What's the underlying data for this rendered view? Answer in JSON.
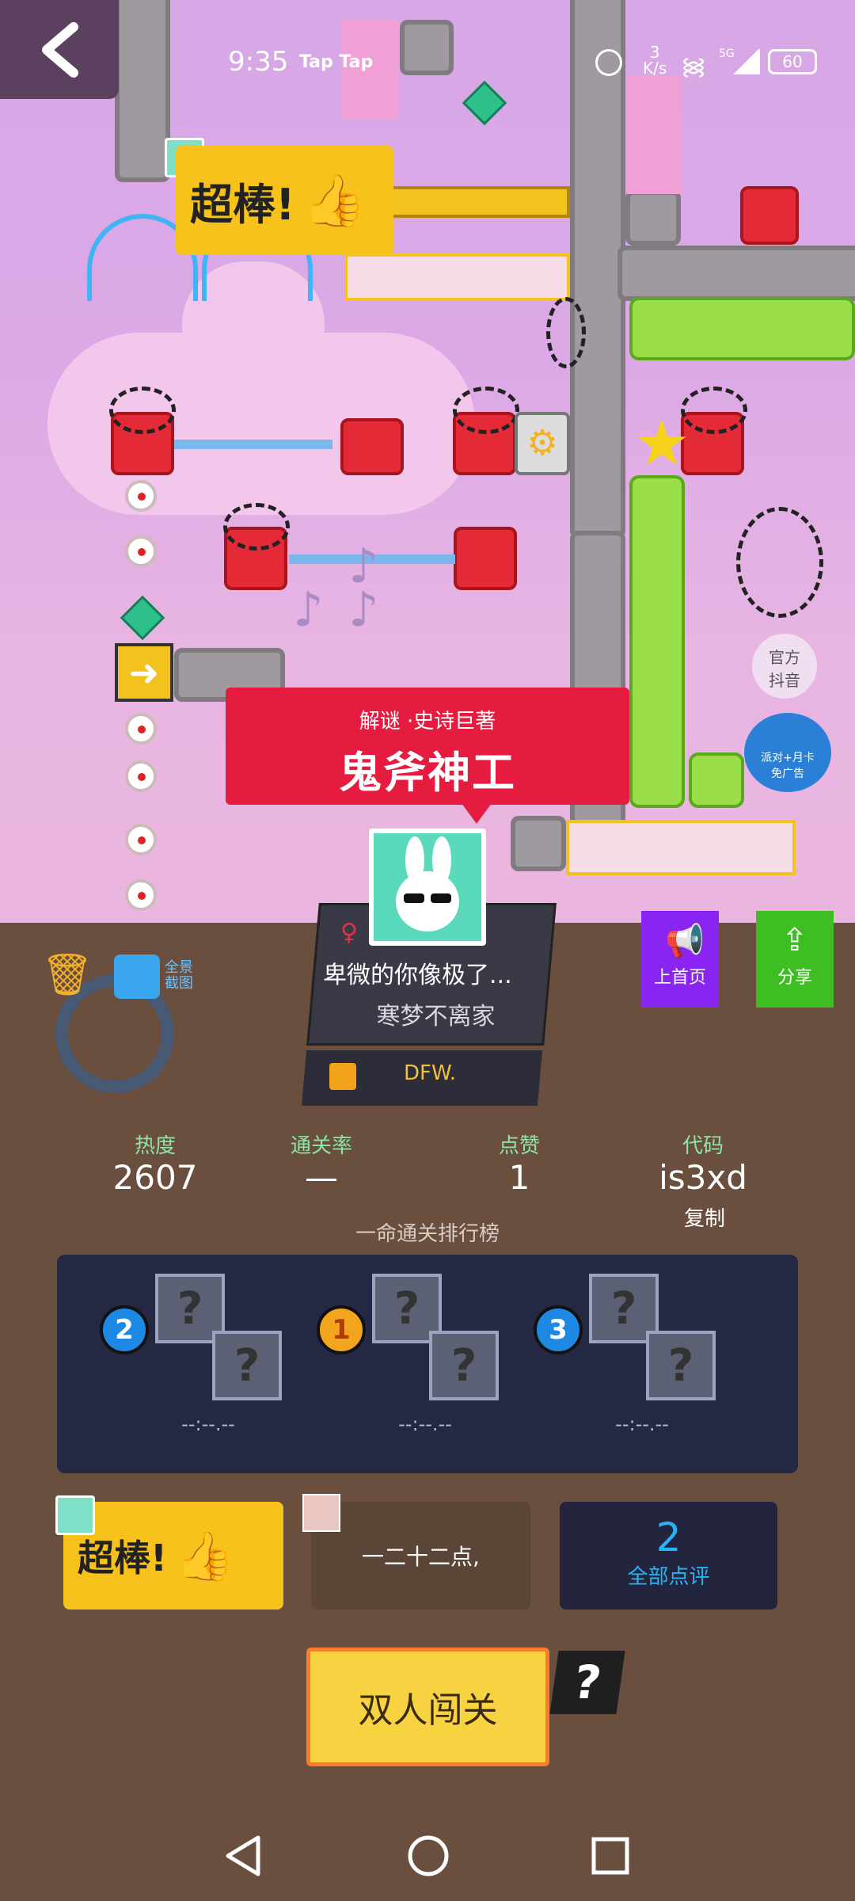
{
  "status": {
    "time": "9:35",
    "app_tags": "Tap Tap",
    "net_speed_value": "3",
    "net_speed_unit": "K/s",
    "battery": "60",
    "network": "5G"
  },
  "game": {
    "stickers": {
      "great": "超棒!"
    },
    "badges": {
      "official": "官方\n抖音",
      "promo": "派对+月卡\n免广告"
    }
  },
  "banner": {
    "subtitle": "解谜 ·史诗巨著",
    "title": "鬼斧神工"
  },
  "author": {
    "level_title": "卑微的你像极了...",
    "name": "寒梦不离家",
    "tag": "DFW."
  },
  "actions": {
    "home": "上首页",
    "share": "分享",
    "screenshot": "全景\n截图"
  },
  "stats": [
    {
      "label": "热度",
      "value": "2607"
    },
    {
      "label": "通关率",
      "value": "—"
    },
    {
      "label": "点赞",
      "value": "1"
    },
    {
      "label": "代码",
      "value": "is3xd"
    }
  ],
  "copy_label": "复制",
  "ranking": {
    "title": "一命通关排行榜",
    "entries": [
      {
        "rank": "2",
        "time": "--:--.--"
      },
      {
        "rank": "1",
        "time": "--:--.--"
      },
      {
        "rank": "3",
        "time": "--:--.--"
      }
    ]
  },
  "comments": {
    "sticker": "超棒!",
    "latest": "一二十二点,",
    "count": "2",
    "all_label": "全部点评"
  },
  "buttons": {
    "coop": "双人闯关",
    "help": "?"
  },
  "colors": {
    "accent_red": "#e51b3f",
    "panel": "#242842",
    "gold": "#f7d342",
    "purple": "#8a24f0",
    "green": "#3fbe24"
  }
}
